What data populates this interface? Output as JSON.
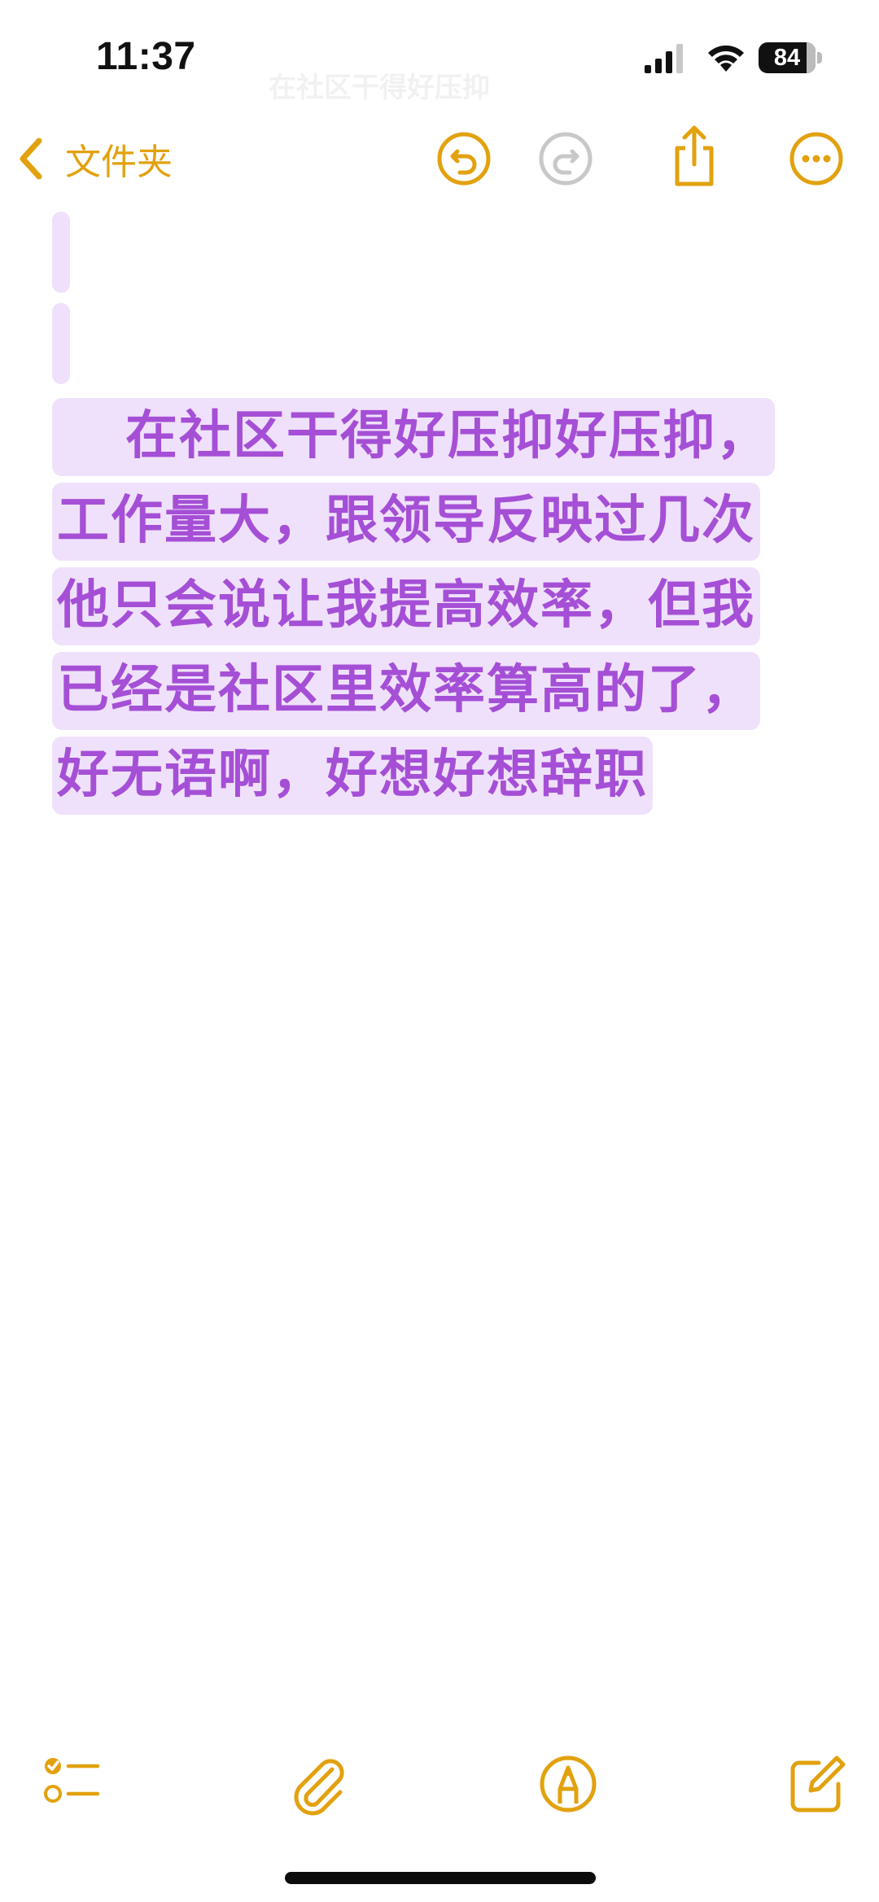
{
  "status_bar": {
    "time": "11:37",
    "battery_percent": "84",
    "battery_level": 0.84,
    "faint_text": "在社区干得好压抑"
  },
  "nav": {
    "back_label": "文件夹",
    "icons": [
      "chevron-left-icon",
      "undo-icon",
      "redo-icon",
      "share-icon",
      "more-icon"
    ]
  },
  "note": {
    "body": "在社区干得好压抑好压抑，工作量大，跟领导反映过几次他只会说让我提高效率，但我已经是社区里效率算高的了，好无语啊，好想好想辞职"
  },
  "toolbar": {
    "icons": [
      "checklist-icon",
      "paperclip-icon",
      "markup-pen-icon",
      "compose-icon"
    ]
  },
  "colors": {
    "accent": "#e2a10e",
    "text_purple": "#a54fd6",
    "highlight": "#efe1fb",
    "disabled_icon": "#c8c8c8"
  }
}
